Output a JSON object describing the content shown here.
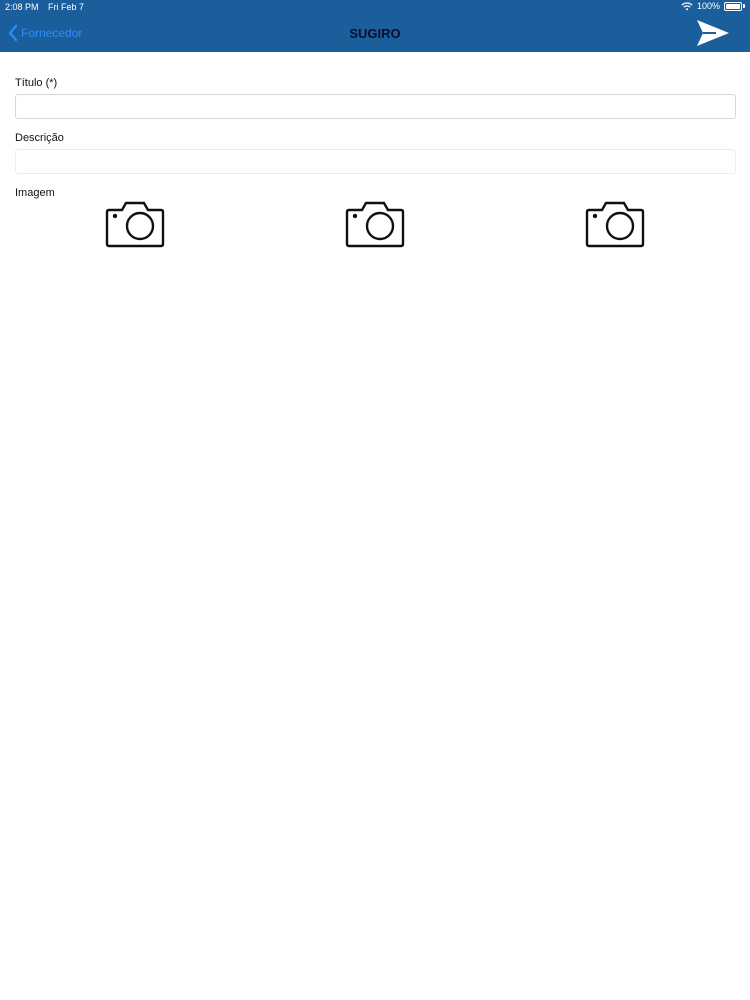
{
  "status_bar": {
    "time": "2:08 PM",
    "date": "Fri Feb 7",
    "battery_text": "100%"
  },
  "nav": {
    "back_label": "Fornecedor",
    "title": "SUGIRO",
    "send_icon": "send-icon"
  },
  "form": {
    "title_label": "Título (*)",
    "title_value": "",
    "description_label": "Descrição",
    "description_value": "",
    "image_label": "Imagem"
  },
  "images": [
    {
      "icon": "camera-icon"
    },
    {
      "icon": "camera-icon"
    },
    {
      "icon": "camera-icon"
    }
  ],
  "colors": {
    "header_bg": "#1b5e9c",
    "back_link": "#2f8cff",
    "title_text": "#0a0f2a"
  }
}
